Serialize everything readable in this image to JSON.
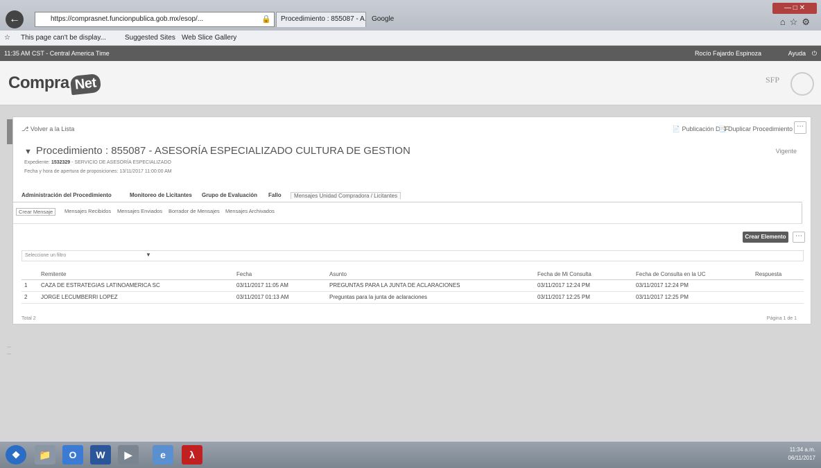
{
  "browser": {
    "url": "https://comprasnet.funcionpublica.gob.mx/esop/...",
    "tab_label": "Procedimiento : 855087 - A...",
    "second_tab": "Google",
    "favorites": [
      "This page can't be display...",
      "Suggested Sites",
      "Web Slice Gallery"
    ]
  },
  "site_bar": {
    "time": "11:35 AM CST - Central America Time",
    "user": "Rocío Fajardo Espinoza",
    "help": "Ayuda"
  },
  "header": {
    "logo_text": "Compra",
    "logo_bubble": "Net",
    "agency": "SFP"
  },
  "page": {
    "back_link": "Volver a la Lista",
    "pub_dof": "Publicación DOF",
    "duplicate": "Duplicar Procedimiento",
    "procedure_title": "Procedimiento : 855087 - ASESORÍA ESPECIALIZADO CULTURA DE GESTION",
    "status": "Vigente",
    "expediente_label": "Expediente:",
    "expediente_num": "1532329",
    "expediente_desc": "- SERVICIO DE ASESORÍA ESPECIALIZADO",
    "apertura": "Fecha y hora de apertura de proposiciones: 13/11/2017 11:00:00 AM"
  },
  "tabs_main": [
    "Administración del Procedimiento",
    "Monitoreo de Licitantes",
    "Grupo de Evaluación",
    "Fallo",
    "Mensajes Unidad Compradora / Licitantes"
  ],
  "tabs_sub": [
    "Crear Mensaje",
    "Mensajes Recibidos",
    "Mensajes Enviados",
    "Borrador de Mensajes",
    "Mensajes Archivados"
  ],
  "actions": {
    "create": "Crear Elemento",
    "filter_placeholder": "Seleccione un filtro"
  },
  "table": {
    "headers": [
      "",
      "Remitente",
      "Fecha",
      "Asunto",
      "Fecha de Mi Consulta",
      "Fecha de Consulta en la UC",
      "Respuesta"
    ],
    "rows": [
      [
        "1",
        "CAZA DE ESTRATEGIAS LATINOAMERICA SC",
        "03/11/2017 11:05 AM",
        "PREGUNTAS PARA LA JUNTA DE ACLARACIONES",
        "03/11/2017 12:24 PM",
        "03/11/2017 12:24 PM",
        ""
      ],
      [
        "2",
        "JORGE LECUMBERRI LOPEZ",
        "03/11/2017 01:13 AM",
        "Preguntas para la junta de aclaraciones",
        "03/11/2017 12:25 PM",
        "03/11/2017 12:25 PM",
        ""
      ]
    ],
    "total": "Total 2",
    "pagination": "Página 1 de 1"
  },
  "taskbar": {
    "time": "11:34 a.m.",
    "date": "06/11/2017"
  }
}
